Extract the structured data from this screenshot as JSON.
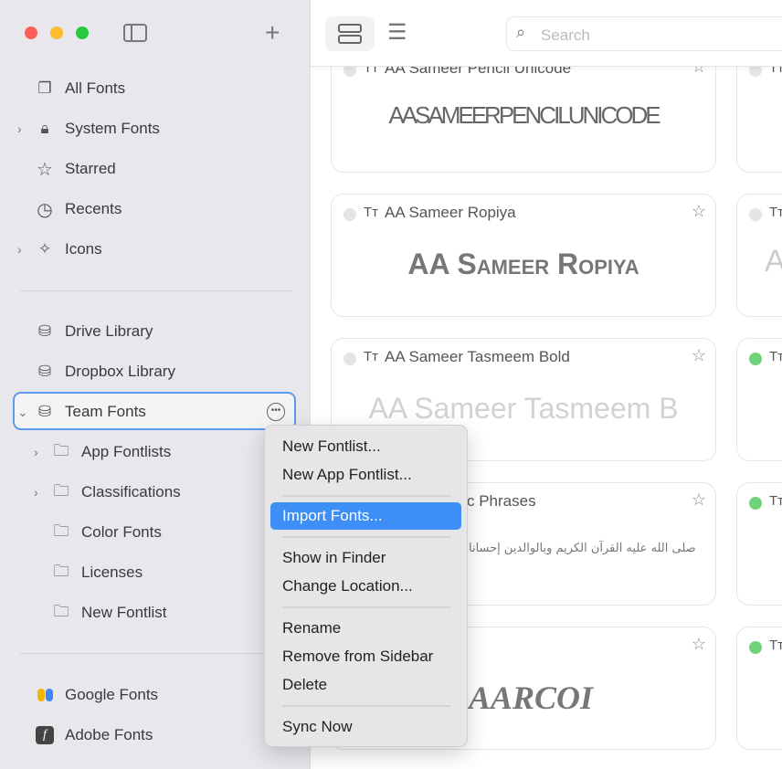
{
  "window": {
    "controls": {
      "close": "#fe5f57",
      "minimize": "#febc2e",
      "zoom": "#28c840"
    }
  },
  "sidebar": {
    "items": [
      {
        "label": "All Fonts",
        "icon": "all-fonts-icon"
      },
      {
        "label": "System Fonts",
        "icon": "lock-icon"
      },
      {
        "label": "Starred",
        "icon": "star-icon"
      },
      {
        "label": "Recents",
        "icon": "clock-icon"
      },
      {
        "label": "Icons",
        "icon": "sparkles-icon"
      },
      {
        "label": "Drive Library",
        "icon": "drive-icon"
      },
      {
        "label": "Dropbox Library",
        "icon": "drive-icon"
      },
      {
        "label": "Team Fonts",
        "icon": "drive-icon"
      },
      {
        "label": "App Fontlists",
        "icon": "folder-icon"
      },
      {
        "label": "Classifications",
        "icon": "folder-icon"
      },
      {
        "label": "Color Fonts",
        "icon": "folder-icon"
      },
      {
        "label": "Licenses",
        "icon": "folder-icon"
      },
      {
        "label": "New Fontlist",
        "icon": "folder-icon"
      },
      {
        "label": "Google Fonts",
        "icon": "google-fonts-icon"
      },
      {
        "label": "Adobe Fonts",
        "icon": "adobe-fonts-icon"
      }
    ]
  },
  "toolbar": {
    "search_placeholder": "Search"
  },
  "cards": [
    {
      "title": "AA Sameer Pencil Unicode",
      "preview": "AASAMEERPENCILUNICODE",
      "active": false
    },
    {
      "title": "AA Sameer Ropiya",
      "preview": "AA Sameer Ropiya",
      "active": false
    },
    {
      "title": "AA Sameer Tasmeem Bold",
      "preview": "AA Sameer Tasmeem B",
      "active": false
    },
    {
      "title": "c Phrases",
      "preview": "صلى الله عليه  القرآن الكريم  وبالوالدين إحسانا",
      "active": false
    },
    {
      "title": "",
      "preview": "AARCOI",
      "active": false
    }
  ],
  "right_cards": [
    {
      "active": false
    },
    {
      "active": false
    },
    {
      "active": true,
      "preview": "A"
    },
    {
      "active": true
    },
    {
      "active": true
    }
  ],
  "colors": {
    "active_dot": "#6fd37b",
    "highlight": "#3d8ef5",
    "selection_border": "#5a9bf0"
  },
  "context_menu": {
    "items": [
      "New Fontlist...",
      "New App Fontlist...",
      "Import Fonts...",
      "Show in Finder",
      "Change Location...",
      "Rename",
      "Remove from Sidebar",
      "Delete",
      "Sync Now"
    ],
    "highlighted": "Import Fonts..."
  }
}
